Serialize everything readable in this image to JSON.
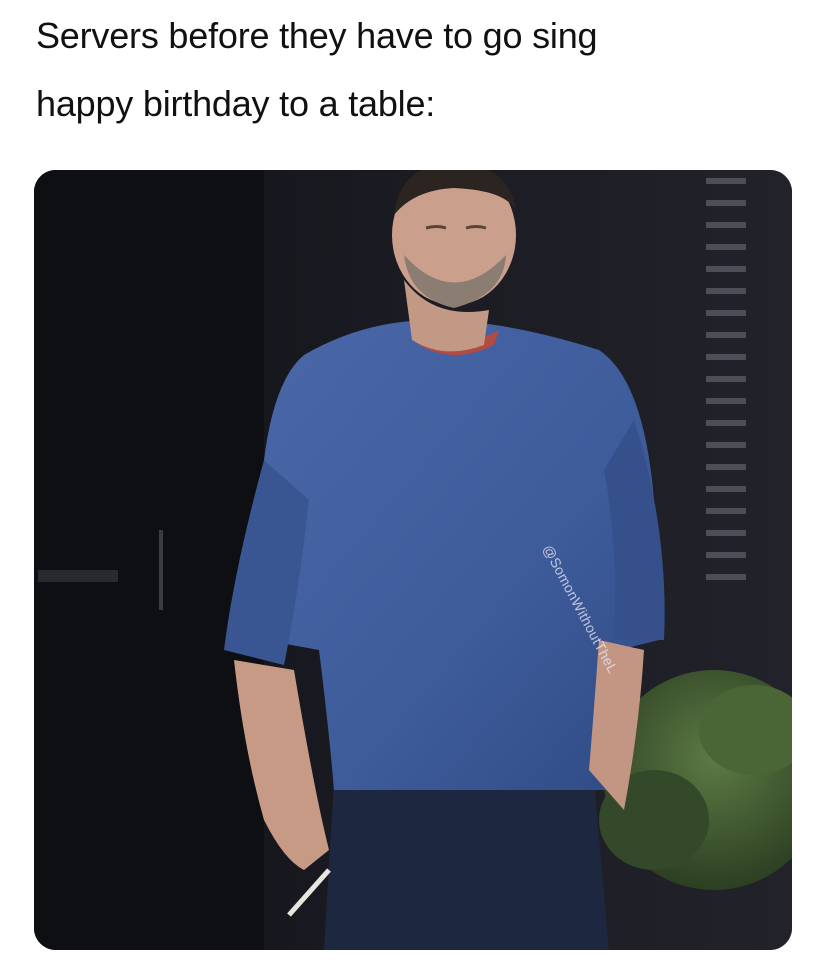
{
  "caption": {
    "line1": "Servers before they have to go sing",
    "line2": "happy birthday to a table:"
  },
  "photo": {
    "watermark": "@SomonWithoutTheL",
    "colors": {
      "background": "#15161b",
      "sweater": "#3e5b9a",
      "jeans": "#1e2740",
      "skin": "#caa08c",
      "shrub": "#3f5a2f"
    }
  }
}
